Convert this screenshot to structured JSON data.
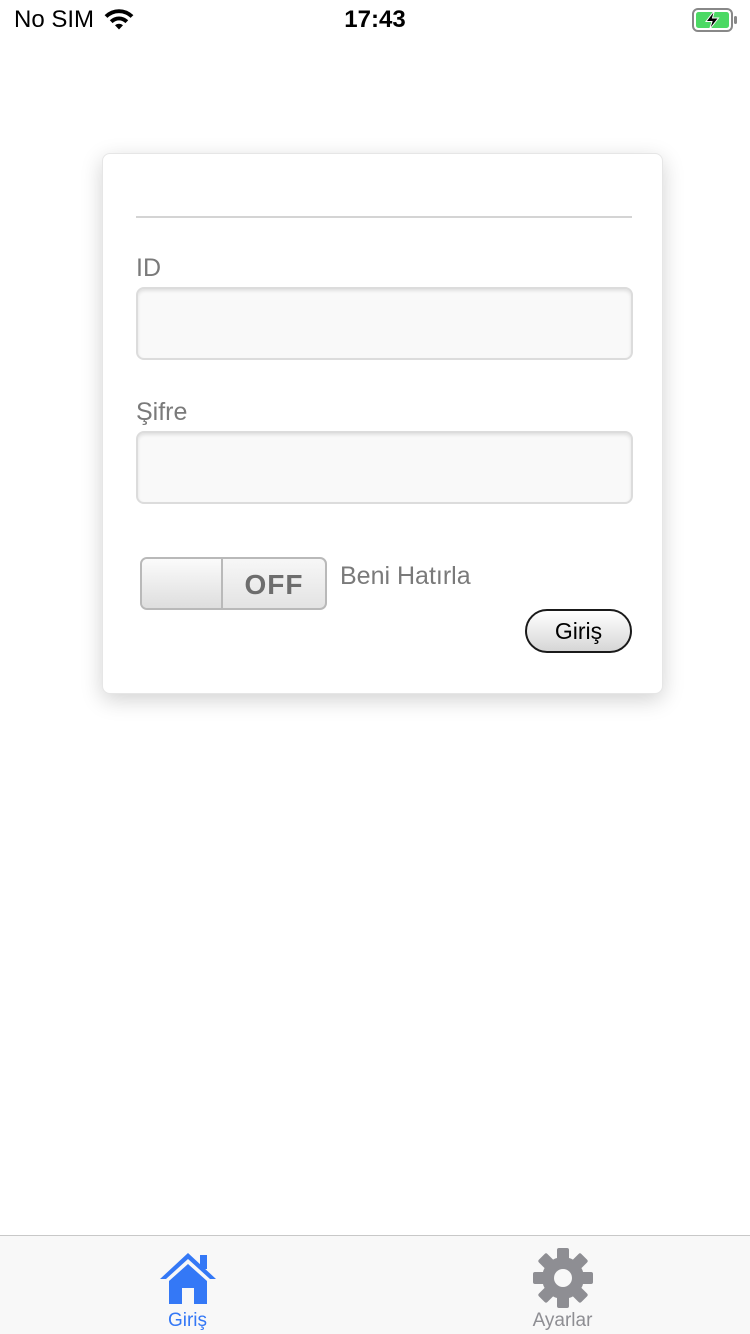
{
  "status_bar": {
    "carrier": "No SIM",
    "time": "17:43"
  },
  "login": {
    "id_label": "ID",
    "id_value": "",
    "password_label": "Şifre",
    "password_value": "",
    "remember_toggle": "OFF",
    "remember_label": "Beni Hatırla",
    "submit_label": "Giriş"
  },
  "tabs": [
    {
      "label": "Giriş",
      "icon": "home-icon",
      "active": true
    },
    {
      "label": "Ayarlar",
      "icon": "gear-icon",
      "active": false
    }
  ],
  "colors": {
    "active_tab": "#3478f6",
    "inactive_tab": "#8e8e93",
    "battery_charge": "#4cd964"
  }
}
